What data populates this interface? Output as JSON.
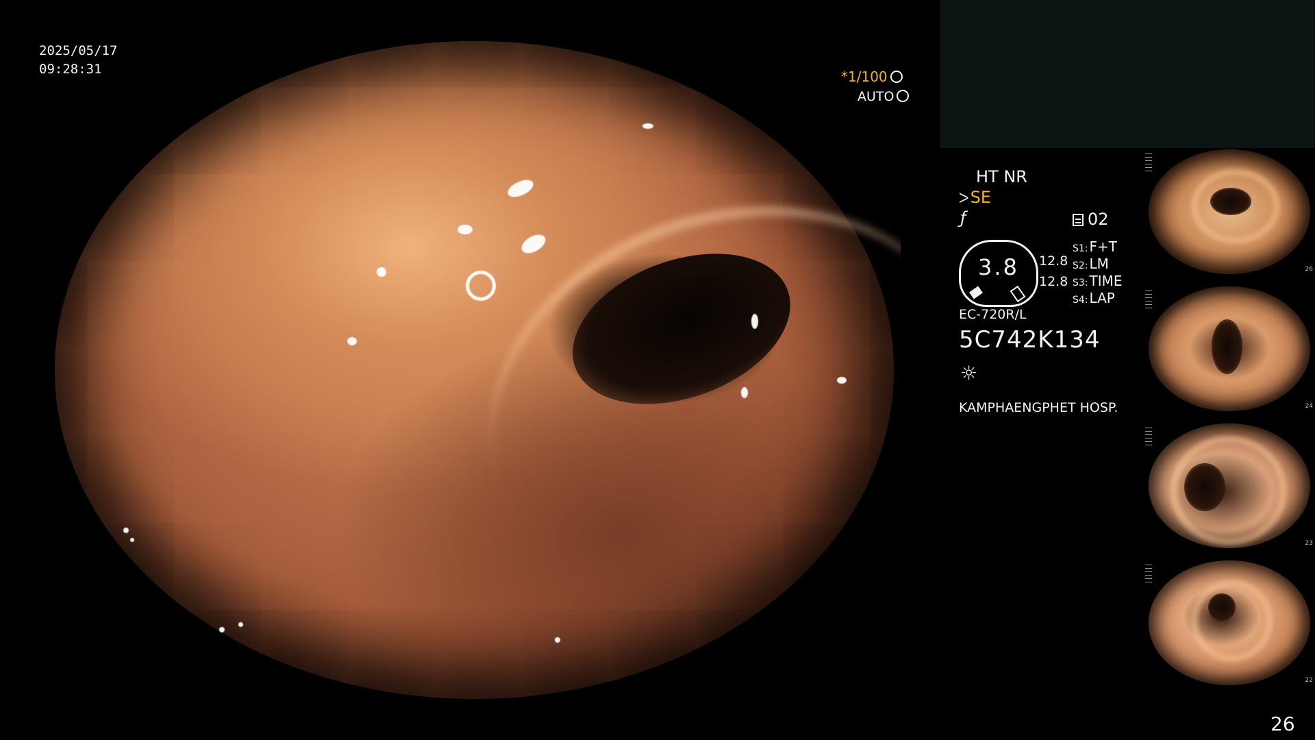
{
  "overlay": {
    "date": "2025/05/17",
    "time": "09:28:31",
    "shutter": "*1/100",
    "auto": "AUTO"
  },
  "info": {
    "ht_nr": "HT NR",
    "se": "SE",
    "f_icon": "ƒ",
    "rec_count": "02",
    "gauge_value": "3.8",
    "values": [
      "12.8",
      "12.8"
    ],
    "switches": [
      {
        "key": "S1:",
        "label": "F+T"
      },
      {
        "key": "S2:",
        "label": "LM"
      },
      {
        "key": "S3:",
        "label": "TIME"
      },
      {
        "key": "S4:",
        "label": "LAP"
      }
    ],
    "model": "EC-720R/L",
    "serial": "5C742K134",
    "light_icon": "☼",
    "hospital": "KAMPHAENGPHET HOSP."
  },
  "thumbnails": [
    {
      "number": "26"
    },
    {
      "number": "24"
    },
    {
      "number": "23"
    },
    {
      "number": "22"
    }
  ],
  "page_number": "26",
  "colors": {
    "accent_yellow": "#f0b428",
    "panel_dark": "#0b1412",
    "tissue": "#c98055"
  }
}
